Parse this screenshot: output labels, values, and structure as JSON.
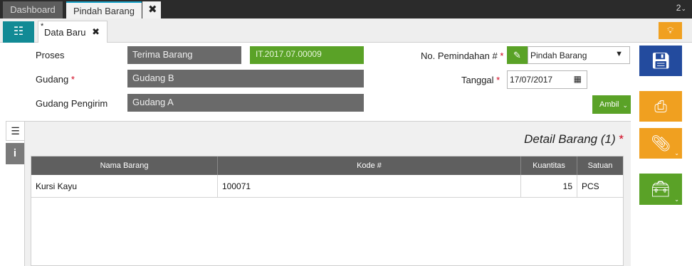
{
  "tabs": {
    "dashboard": "Dashboard",
    "active": "Pindah Barang",
    "close": "✖",
    "count": "2"
  },
  "doc_tab": {
    "marker": "*",
    "label": "Data Baru",
    "close": "✖"
  },
  "icons": {
    "list": "list-icon",
    "bulb": "lightbulb-icon",
    "edit": "pencil-icon",
    "calendar": "calendar-icon",
    "save": "save-icon",
    "print": "print-icon",
    "attach": "paperclip-icon",
    "tools": "toolbox-icon",
    "detail": "document-icon",
    "info": "info-icon"
  },
  "form": {
    "proses_label": "Proses",
    "proses_value": "Terima Barang",
    "kode_value": "IT.2017.07.00009",
    "gudang_label": "Gudang",
    "gudang_value": "Gudang B",
    "pengirim_label": "Gudang Pengirim",
    "pengirim_value": "Gudang A",
    "nopem_label": "No. Pemindahan #",
    "nopem_value": "Pindah Barang",
    "tanggal_label": "Tanggal",
    "tanggal_value": "17/07/2017",
    "ambil_label": "Ambil",
    "required_mark": "*"
  },
  "detail": {
    "title": "Detail Barang (1)",
    "required_mark": "*",
    "columns": [
      "Nama Barang",
      "Kode #",
      "Kuantitas",
      "Satuan"
    ],
    "rows": [
      {
        "nama": "Kursi Kayu",
        "kode": "100071",
        "qty": "15",
        "satuan": "PCS"
      }
    ]
  },
  "colors": {
    "topbar": "#2b2b2b",
    "teal": "#128a95",
    "green": "#5aa227",
    "orange": "#f0a020",
    "navy": "#234b9e",
    "field_gray": "#6a6a6a",
    "required": "#d0021b"
  }
}
